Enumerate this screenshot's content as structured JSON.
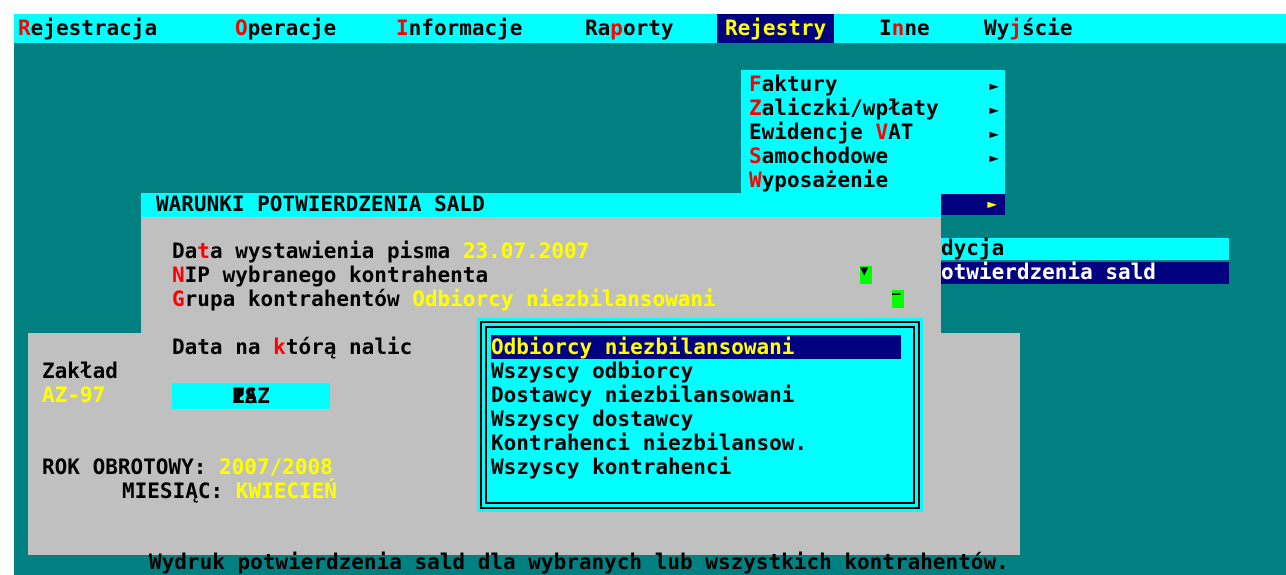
{
  "menu": {
    "items": [
      {
        "first": "R",
        "rest": "ejestracja"
      },
      {
        "first": "O",
        "rest": "peracje"
      },
      {
        "first": "I",
        "rest": "nformacje"
      },
      {
        "pre": "Ra",
        "hot": "p",
        "rest": "orty"
      },
      {
        "label": "Rejestry"
      },
      {
        "pre": "I",
        "hot": "n",
        "rest": "ne"
      },
      {
        "pre": "Wy",
        "hot": "j",
        "rest": "ście"
      }
    ]
  },
  "dropdown": {
    "items": [
      {
        "hot": "F",
        "rest": "aktury",
        "arrow": "►"
      },
      {
        "hot": "Z",
        "rest": "aliczki/wpłaty",
        "arrow": "►"
      },
      {
        "pre": "Ewidencje ",
        "hot": "V",
        "rest": "AT",
        "arrow": "►"
      },
      {
        "hot": "S",
        "rest": "amochodowe",
        "arrow": "►"
      },
      {
        "hot": "W",
        "rest": "yposażenie",
        "arrow": ""
      }
    ],
    "submenu_arrow": "►"
  },
  "background_items": {
    "item_a": "dycja",
    "item_b": "otwierdzenia sald"
  },
  "dialog": {
    "title": "WARUNKI POTWIERDZENIA SALD",
    "date_label_pre": "Da",
    "date_label_hot": "t",
    "date_label_rest": "a wystawienia pisma ",
    "date_value": "23.07.2007",
    "nip_label_hot": "N",
    "nip_label_rest": "IP wybranego kontrahenta",
    "nip_marker": "▼",
    "group_label_hot": "G",
    "group_label_rest": "rupa kontrahentów ",
    "group_value": "Odbiorcy niezbilansowani",
    "group_marker": "–",
    "calc_label_pre": "Data na ",
    "calc_label_hot": "k",
    "calc_label_rest": "tórą nalic",
    "plant_label": "Zakład",
    "plant_value": "AZ-97",
    "save_pre": "ZA",
    "save_hot": "P",
    "save_rest": "ISZ",
    "year_label": "ROK OBROTOWY: ",
    "year_value": "2007/2008",
    "month_label": "MIESIĄC: ",
    "month_value": "KWIECIEŃ"
  },
  "popup": {
    "options": [
      "Odbiorcy niezbilansowani",
      "Wszyscy odbiorcy",
      "Dostawcy niezbilansowani",
      "Wszyscy dostawcy",
      "Kontrahenci niezbilansow.",
      "Wszyscy kontrahenci"
    ],
    "selected": "Odbiorcy niezbilansowani"
  },
  "status": "Wydruk potwierdzenia sald dla wybranych lub wszystkich kontrahentów.",
  "colors": {
    "screen_bg": "#008080",
    "cyan": "#00ffff",
    "navy": "#000080",
    "gray": "#c0c0c0",
    "yellow": "#ffff00",
    "hotkey_red": "#ff0000"
  }
}
